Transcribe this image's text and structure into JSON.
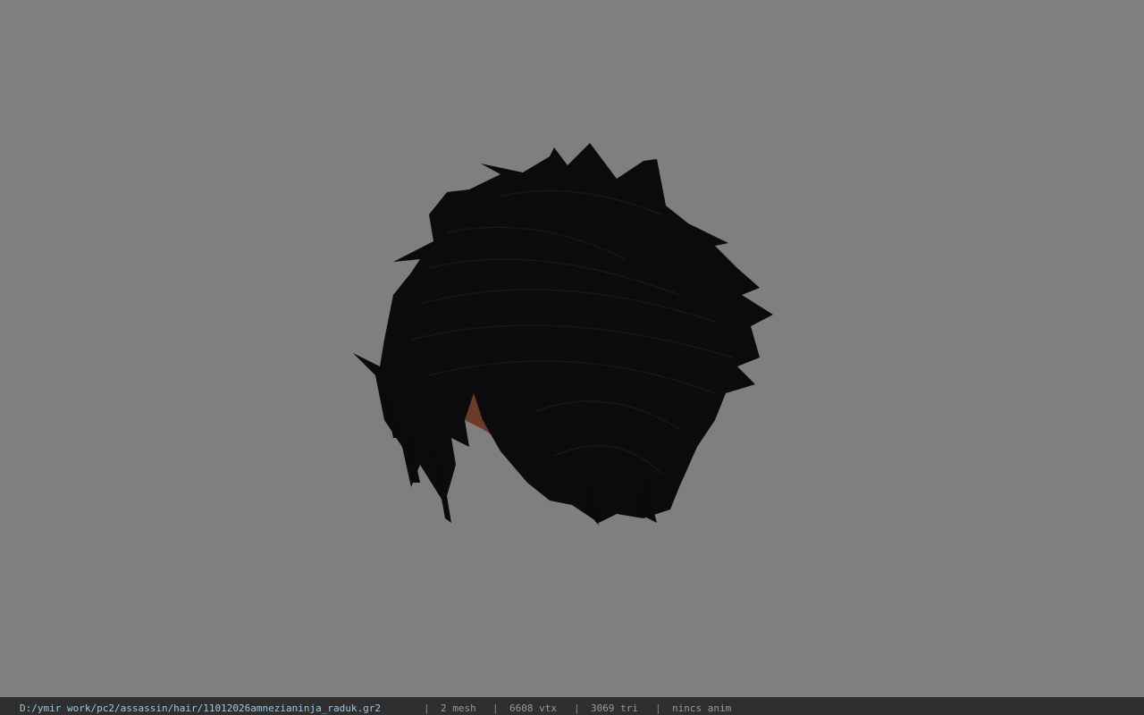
{
  "viewer": {
    "background_color": "#7f7f7f",
    "model_subject": "hair-mesh"
  },
  "statusbar": {
    "file_path": "D:/ymir work/pc2/assassin/hair/11012026amnezianinja_raduk.gr2",
    "separator": "|",
    "mesh_count": "2 mesh",
    "vertex_count": "6608 vtx",
    "triangle_count": "3069 tri",
    "anim_status": "nincs anim",
    "path_color": "#9ec8dc"
  }
}
